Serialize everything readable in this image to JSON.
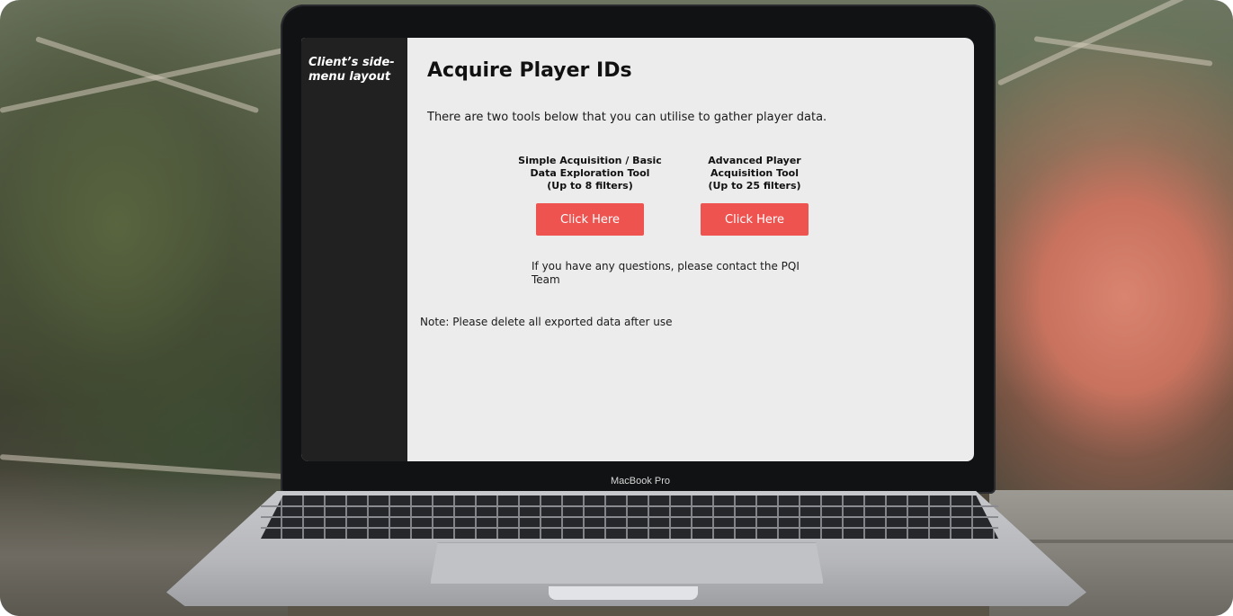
{
  "sidebar": {
    "label": "Client’s side-menu layout"
  },
  "main": {
    "title": "Acquire Player IDs",
    "intro": "There are two tools below that you can utilise to gather player data.",
    "tools": [
      {
        "caption": "Simple Acquisition / Basic\nData Exploration Tool\n(Up to 8 filters)",
        "button_label": "Click Here"
      },
      {
        "caption": "Advanced Player\nAcquisition Tool\n(Up to 25 filters)",
        "button_label": "Click Here"
      }
    ],
    "contact": "If you have any questions, please contact the PQI Team",
    "note": "Note: Please delete all exported data after use"
  },
  "device": {
    "brand_label": "MacBook Pro"
  },
  "colors": {
    "button": "#ef5350",
    "sidebar": "#212121",
    "content_bg": "#ececec"
  }
}
